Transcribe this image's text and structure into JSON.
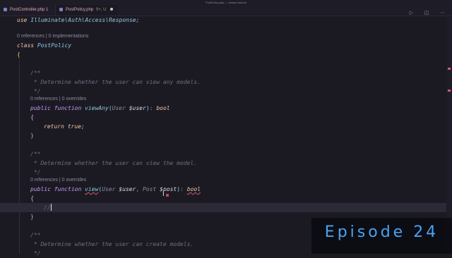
{
  "window": {
    "title": "PostPolicy.php — laravel-tutorial"
  },
  "tabs": [
    {
      "label": "PostController.php",
      "status": "1"
    },
    {
      "label": "PostPolicy.php",
      "status": "9+, U"
    }
  ],
  "toolbar": {
    "run_icon": "play-icon",
    "split_icon": "split-editor-icon",
    "more_icon": "more-icon"
  },
  "editor": {
    "codelens": [
      "0 references | 0 implementations",
      "0 references | 0 overrides",
      "0 references | 0 overrides"
    ],
    "code": {
      "use_kw": "use",
      "use_ns": "Illuminate\\Auth\\Access\\Response;",
      "class_kw": "class",
      "class_name": "PostPolicy",
      "brace_open": "{",
      "brace_close": "}",
      "doc_open": "/**",
      "doc_close": "*/",
      "doc_viewany": "* Determine whether the user can view any models.",
      "doc_view": "* Determine whether the user can view the model.",
      "doc_create": "* Determine whether the user can create models.",
      "public_kw": "public",
      "function_kw": "function",
      "fn_viewany": "viewAny",
      "fn_view": "view",
      "type_user": "User",
      "var_user": "$user",
      "type_post": "Post",
      "var_post": "$post",
      "comma": ",",
      "return_type": "bool",
      "colon": ":",
      "paren_open": "(",
      "paren_close": ")",
      "return_kw": "return",
      "true_kw": "true;",
      "comment_slashes": "//"
    }
  },
  "overlay": {
    "episode": "Episode 24"
  }
}
